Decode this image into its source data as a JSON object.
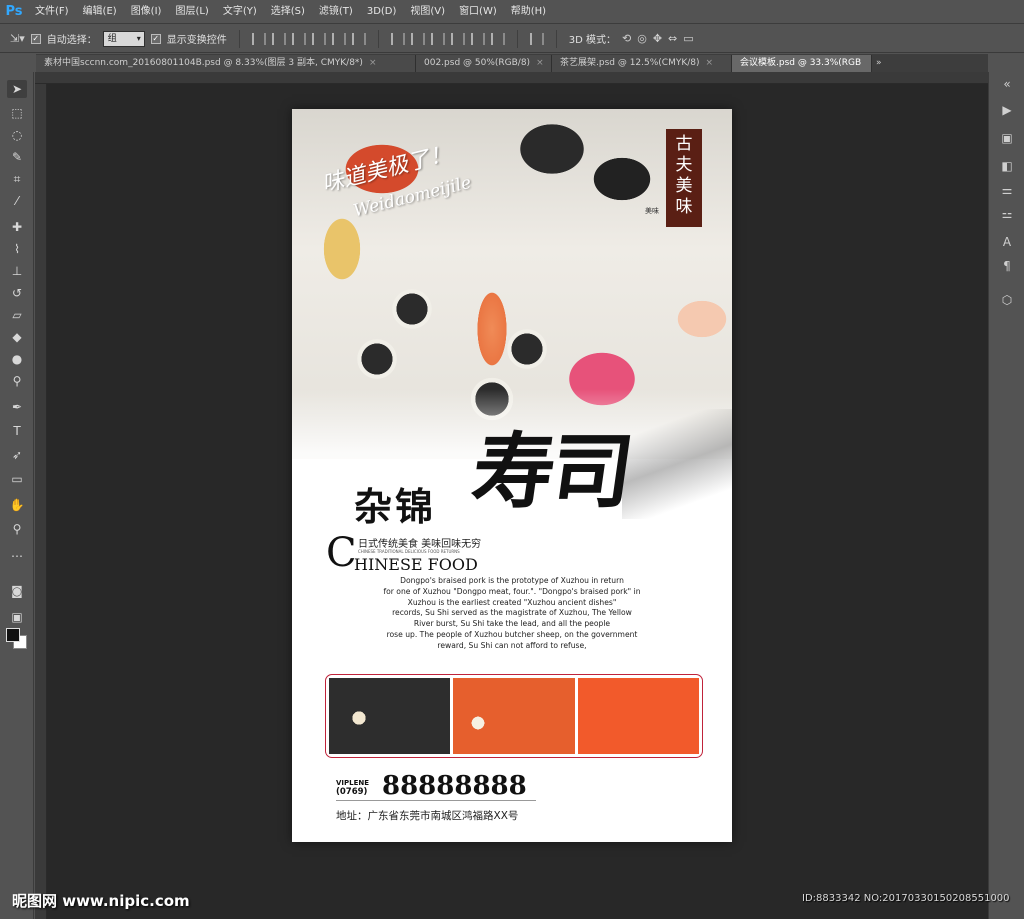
{
  "app": {
    "logo": "Ps",
    "menu": [
      "文件(F)",
      "编辑(E)",
      "图像(I)",
      "图层(L)",
      "文字(Y)",
      "选择(S)",
      "滤镜(T)",
      "3D(D)",
      "视图(V)",
      "窗口(W)",
      "帮助(H)"
    ]
  },
  "options": {
    "auto_select_label": "自动选择：",
    "auto_select_value": "组",
    "show_transform_label": "显示变换控件",
    "mode_label": "3D 模式："
  },
  "tabs": [
    {
      "label": "素材中国sccnn.com_20160801104B.psd @ 8.33%(图层 3 副本, CMYK/8*)",
      "active": false
    },
    {
      "label": "002.psd @ 50%(RGB/8)",
      "active": false
    },
    {
      "label": "茶艺展架.psd @ 12.5%(CMYK/8)",
      "active": false
    },
    {
      "label": "会议模板.psd @ 33.3%(RGB",
      "active": true
    }
  ],
  "poster": {
    "slogan_cn": "味道美极了！",
    "slogan_en": "Weidaomeijile",
    "seal_text": [
      "古",
      "夫",
      "美",
      "味"
    ],
    "seal_small": "美味",
    "title_cn": "杂锦",
    "title_script": "寿司",
    "tagline": "日式传统美食  美味回味无穷",
    "tagline_tiny": "CHINESE TRADITIONAL DELICIOUS FOOD RETURNS",
    "cf_big": "C",
    "cf_rest": "HINESE FOOD",
    "body": [
      "Dongpo's braised pork is the prototype of Xuzhou in return",
      "for one of Xuzhou \"Dongpo meat, four.\". \"Dongpo's braised pork\" in",
      "Xuzhou is the earliest created \"Xuzhou ancient dishes\"",
      "records, Su Shi served as the magistrate of Xuzhou, The Yellow",
      "River burst, Su Shi take the lead, and all the people",
      "rose up. The people of Xuzhou butcher sheep, on the government",
      "reward, Su Shi can not afford to refuse,"
    ],
    "phone_label": "VIPLENE",
    "phone_code": "(0769)",
    "phone_number": "88888888",
    "address": "地址：广东省东莞市南城区鸿福路XX号"
  },
  "watermark": {
    "left": "昵图网 www.nipic.com",
    "right": "ID:8833342 NO:20170330150208551000"
  }
}
